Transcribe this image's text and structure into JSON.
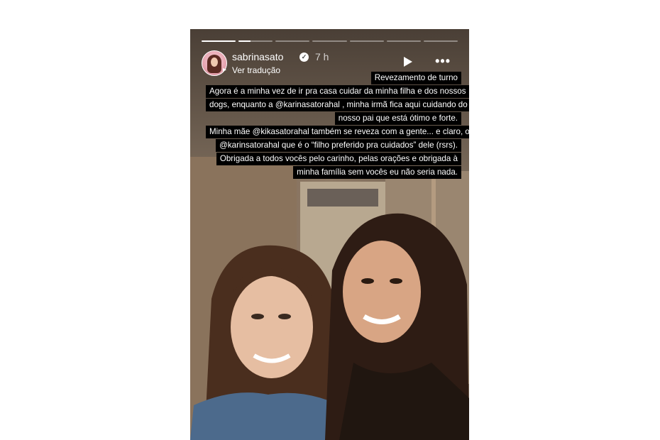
{
  "story": {
    "username": "sabrinasato",
    "time": "7 h",
    "translate_label": "Ver tradução",
    "progress": [
      1,
      0.35,
      0,
      0,
      0,
      0,
      0
    ]
  },
  "caption": {
    "lines": [
      "Revezamento de turno",
      "Agora é a minha vez de ir pra casa cuidar da minha filha e dos nossos",
      "dogs, enquanto a @karinasatorahal , minha irmã fica aqui cuidando do",
      "nosso pai que está ótimo e forte.",
      "Minha mãe @kikasatorahal também se reveza com a gente... e claro, o",
      "@karinsatorahal que é o “filho preferido pra cuidados” dele (rsrs).",
      "Obrigada a todos vocês pelo carinho, pelas orações e obrigada à",
      "minha família sem vocês eu não seria nada."
    ]
  },
  "icons": {
    "verified": "verified-badge-icon",
    "play": "play-icon",
    "more": "more-options-icon",
    "translate": "translate-icon"
  }
}
